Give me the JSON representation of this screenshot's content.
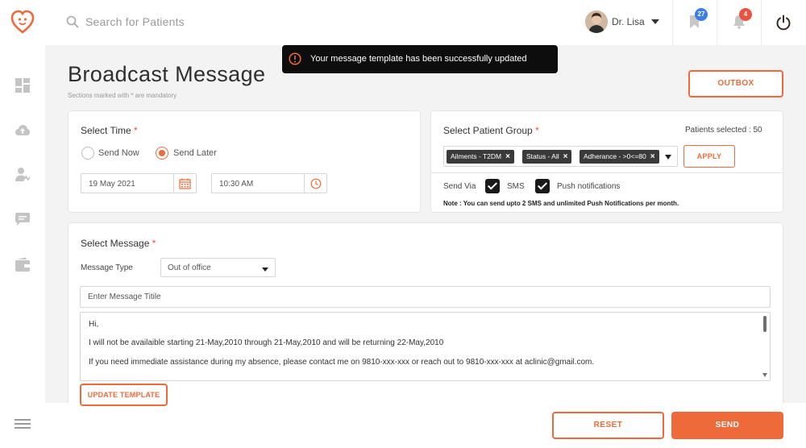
{
  "topbar": {
    "search_placeholder": "Search for Patients",
    "user_name": "Dr. Lisa",
    "bookmark_count": "27",
    "notification_count": "4"
  },
  "toast": {
    "message": "Your message template has been successfully updated"
  },
  "page": {
    "title": "Broadcast Message",
    "subtitle": "Sections marked with * are mandatory",
    "outbox_label": "OUTBOX"
  },
  "select_time": {
    "title": "Select Time",
    "required_mark": "*",
    "send_now_label": "Send Now",
    "send_later_label": "Send Later",
    "selected": "Send Later",
    "date": "19 May 2021",
    "time": "10:30 AM"
  },
  "patient_group": {
    "title": "Select Patient Group",
    "required_mark": "*",
    "patients_selected": "Patients selected : 50",
    "tags": [
      "Ailments - T2DM",
      "Status - All",
      "Adherance - >0<=80"
    ],
    "apply_label": "APPLY",
    "send_via_label": "Send Via",
    "sms_label": "SMS",
    "push_label": "Push notifications",
    "note": "Note : You can send upto 2 SMS and unlimited Push Notifications per month."
  },
  "select_message": {
    "title": "Select Message",
    "required_mark": "*",
    "message_type_label": "Message Type",
    "message_type_value": "Out of office",
    "title_placeholder": "Enter Message Titile",
    "body_lines": [
      "Hi,",
      "I will not be availaible starting 21-May,2010 through 21-May,2010 and will be returning 22-May,2010",
      "If you need immediate assistance during my absence, please contact me on 9810-xxx-xxx or reach out to 9810-xxx-xxx at aclinic@gmail.com."
    ],
    "update_label": "UPDATE TEMPLATE"
  },
  "footer": {
    "reset_label": "RESET",
    "send_label": "SEND"
  },
  "colors": {
    "accent": "#ee6a3a",
    "badge_blue": "#3b7fe0",
    "badge_red": "#e9533f",
    "toast_bg": "#0d0d0d"
  },
  "icons": [
    "heart-logo-icon",
    "search-icon",
    "bookmark-icon",
    "bell-icon",
    "power-icon",
    "dashboard-icon",
    "upload-icon",
    "patients-icon",
    "chat-icon",
    "wallet-icon",
    "menu-icon",
    "calendar-icon",
    "clock-icon",
    "alert-icon"
  ]
}
